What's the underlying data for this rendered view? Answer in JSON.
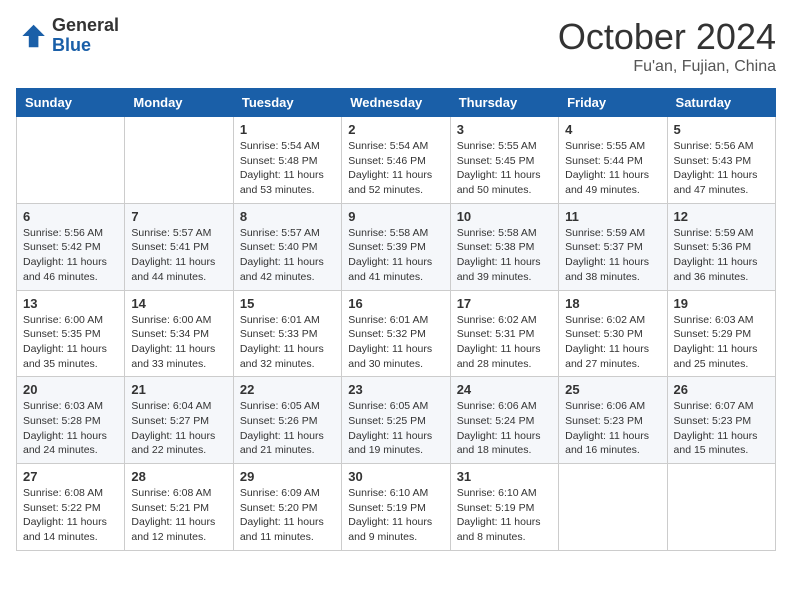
{
  "header": {
    "logo_general": "General",
    "logo_blue": "Blue",
    "month_title": "October 2024",
    "location": "Fu'an, Fujian, China"
  },
  "weekdays": [
    "Sunday",
    "Monday",
    "Tuesday",
    "Wednesday",
    "Thursday",
    "Friday",
    "Saturday"
  ],
  "weeks": [
    [
      {
        "day": "",
        "info": ""
      },
      {
        "day": "",
        "info": ""
      },
      {
        "day": "1",
        "info": "Sunrise: 5:54 AM\nSunset: 5:48 PM\nDaylight: 11 hours and 53 minutes."
      },
      {
        "day": "2",
        "info": "Sunrise: 5:54 AM\nSunset: 5:46 PM\nDaylight: 11 hours and 52 minutes."
      },
      {
        "day": "3",
        "info": "Sunrise: 5:55 AM\nSunset: 5:45 PM\nDaylight: 11 hours and 50 minutes."
      },
      {
        "day": "4",
        "info": "Sunrise: 5:55 AM\nSunset: 5:44 PM\nDaylight: 11 hours and 49 minutes."
      },
      {
        "day": "5",
        "info": "Sunrise: 5:56 AM\nSunset: 5:43 PM\nDaylight: 11 hours and 47 minutes."
      }
    ],
    [
      {
        "day": "6",
        "info": "Sunrise: 5:56 AM\nSunset: 5:42 PM\nDaylight: 11 hours and 46 minutes."
      },
      {
        "day": "7",
        "info": "Sunrise: 5:57 AM\nSunset: 5:41 PM\nDaylight: 11 hours and 44 minutes."
      },
      {
        "day": "8",
        "info": "Sunrise: 5:57 AM\nSunset: 5:40 PM\nDaylight: 11 hours and 42 minutes."
      },
      {
        "day": "9",
        "info": "Sunrise: 5:58 AM\nSunset: 5:39 PM\nDaylight: 11 hours and 41 minutes."
      },
      {
        "day": "10",
        "info": "Sunrise: 5:58 AM\nSunset: 5:38 PM\nDaylight: 11 hours and 39 minutes."
      },
      {
        "day": "11",
        "info": "Sunrise: 5:59 AM\nSunset: 5:37 PM\nDaylight: 11 hours and 38 minutes."
      },
      {
        "day": "12",
        "info": "Sunrise: 5:59 AM\nSunset: 5:36 PM\nDaylight: 11 hours and 36 minutes."
      }
    ],
    [
      {
        "day": "13",
        "info": "Sunrise: 6:00 AM\nSunset: 5:35 PM\nDaylight: 11 hours and 35 minutes."
      },
      {
        "day": "14",
        "info": "Sunrise: 6:00 AM\nSunset: 5:34 PM\nDaylight: 11 hours and 33 minutes."
      },
      {
        "day": "15",
        "info": "Sunrise: 6:01 AM\nSunset: 5:33 PM\nDaylight: 11 hours and 32 minutes."
      },
      {
        "day": "16",
        "info": "Sunrise: 6:01 AM\nSunset: 5:32 PM\nDaylight: 11 hours and 30 minutes."
      },
      {
        "day": "17",
        "info": "Sunrise: 6:02 AM\nSunset: 5:31 PM\nDaylight: 11 hours and 28 minutes."
      },
      {
        "day": "18",
        "info": "Sunrise: 6:02 AM\nSunset: 5:30 PM\nDaylight: 11 hours and 27 minutes."
      },
      {
        "day": "19",
        "info": "Sunrise: 6:03 AM\nSunset: 5:29 PM\nDaylight: 11 hours and 25 minutes."
      }
    ],
    [
      {
        "day": "20",
        "info": "Sunrise: 6:03 AM\nSunset: 5:28 PM\nDaylight: 11 hours and 24 minutes."
      },
      {
        "day": "21",
        "info": "Sunrise: 6:04 AM\nSunset: 5:27 PM\nDaylight: 11 hours and 22 minutes."
      },
      {
        "day": "22",
        "info": "Sunrise: 6:05 AM\nSunset: 5:26 PM\nDaylight: 11 hours and 21 minutes."
      },
      {
        "day": "23",
        "info": "Sunrise: 6:05 AM\nSunset: 5:25 PM\nDaylight: 11 hours and 19 minutes."
      },
      {
        "day": "24",
        "info": "Sunrise: 6:06 AM\nSunset: 5:24 PM\nDaylight: 11 hours and 18 minutes."
      },
      {
        "day": "25",
        "info": "Sunrise: 6:06 AM\nSunset: 5:23 PM\nDaylight: 11 hours and 16 minutes."
      },
      {
        "day": "26",
        "info": "Sunrise: 6:07 AM\nSunset: 5:23 PM\nDaylight: 11 hours and 15 minutes."
      }
    ],
    [
      {
        "day": "27",
        "info": "Sunrise: 6:08 AM\nSunset: 5:22 PM\nDaylight: 11 hours and 14 minutes."
      },
      {
        "day": "28",
        "info": "Sunrise: 6:08 AM\nSunset: 5:21 PM\nDaylight: 11 hours and 12 minutes."
      },
      {
        "day": "29",
        "info": "Sunrise: 6:09 AM\nSunset: 5:20 PM\nDaylight: 11 hours and 11 minutes."
      },
      {
        "day": "30",
        "info": "Sunrise: 6:10 AM\nSunset: 5:19 PM\nDaylight: 11 hours and 9 minutes."
      },
      {
        "day": "31",
        "info": "Sunrise: 6:10 AM\nSunset: 5:19 PM\nDaylight: 11 hours and 8 minutes."
      },
      {
        "day": "",
        "info": ""
      },
      {
        "day": "",
        "info": ""
      }
    ]
  ]
}
